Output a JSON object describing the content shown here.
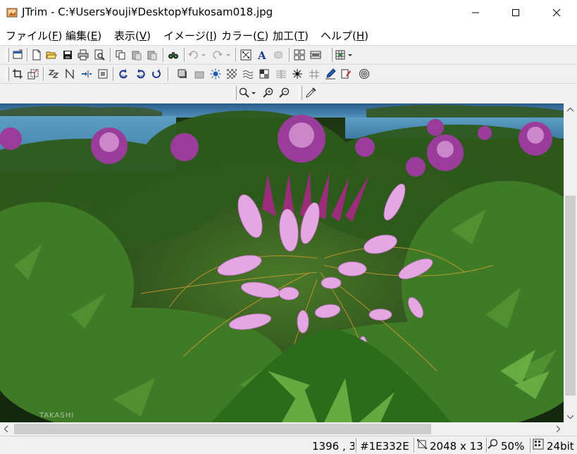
{
  "window": {
    "title": "JTrim - C:¥Users¥ouji¥Desktop¥fukosam018.jpg"
  },
  "menu": [
    {
      "label": "ファイル(",
      "key": "F",
      "end": ")"
    },
    {
      "label": "編集(",
      "key": "E",
      "end": ")"
    },
    {
      "label": "表示(",
      "key": "V",
      "end": ")"
    },
    {
      "label": "イメージ(",
      "key": "I",
      "end": ")"
    },
    {
      "label": "カラー(",
      "key": "C",
      "end": ")"
    },
    {
      "label": "加工(",
      "key": "T",
      "end": ")"
    },
    {
      "label": "ヘルプ(",
      "key": "H",
      "end": ")"
    }
  ],
  "image": {
    "watermark": "TAKASHI",
    "background_color": "#1E332E"
  },
  "status": {
    "coords": "1396 , 3",
    "color": "#1E332E",
    "size": "2048 x 13",
    "zoom": "50%",
    "depth": "24bit"
  },
  "colors": {
    "accent_blue": "#1f5fb5",
    "flower_pink": "#d89ad8",
    "flower_magenta": "#a0308a",
    "foliage": "#2f5a1e"
  }
}
